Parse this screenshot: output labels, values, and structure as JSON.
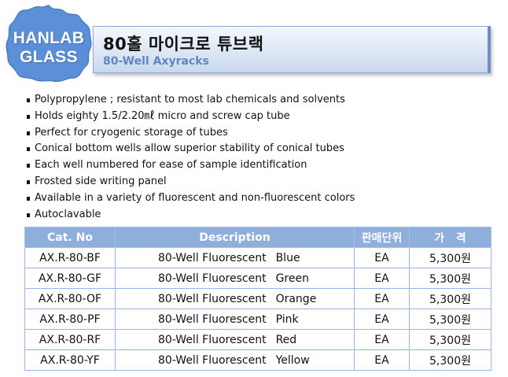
{
  "badge": {
    "line1": "HANLAB",
    "line2": "GLASS"
  },
  "header": {
    "title": "80홀 마이크로 튜브랙",
    "subtitle": "80-Well Axyracks"
  },
  "features": [
    "Polypropylene  ; resistant to most lab chemicals and solvents",
    "Holds eighty 1.5/2.20㎖ micro and screw cap tube",
    "Perfect for cryogenic storage of tubes",
    "Conical bottom wells allow superior stability of conical tubes",
    "Each well numbered for ease of sample identification",
    "Frosted side writing panel",
    "Available in a variety of fluorescent and non-fluorescent colors",
    "Autoclavable"
  ],
  "table": {
    "headers": [
      "Cat. No",
      "Description",
      "판매단위",
      "가   격"
    ],
    "rows": [
      {
        "cat": "AX.R-80-BF",
        "desc": "80-Well Fluorescent",
        "color": "Blue",
        "unit": "EA",
        "price": "5,300원"
      },
      {
        "cat": "AX.R-80-GF",
        "desc": "80-Well Fluorescent",
        "color": "Green",
        "unit": "EA",
        "price": "5,300원"
      },
      {
        "cat": "AX.R-80-OF",
        "desc": "80-Well Fluorescent",
        "color": "Orange",
        "unit": "EA",
        "price": "5,300원"
      },
      {
        "cat": "AX.R-80-PF",
        "desc": "80-Well Fluorescent",
        "color": "Pink",
        "unit": "EA",
        "price": "5,300원"
      },
      {
        "cat": "AX.R-80-RF",
        "desc": "80-Well Fluorescent",
        "color": "Red",
        "unit": "EA",
        "price": "5,300원"
      },
      {
        "cat": "AX.R-80-YF",
        "desc": "80-Well Fluorescent",
        "color": "Yellow",
        "unit": "EA",
        "price": "5,300원"
      }
    ]
  },
  "colors": {
    "badge_fill": "#5b8fd8",
    "header_accent": "#6e8fc3",
    "subtitle": "#5f86c4",
    "table_header": "#8eaedb"
  }
}
